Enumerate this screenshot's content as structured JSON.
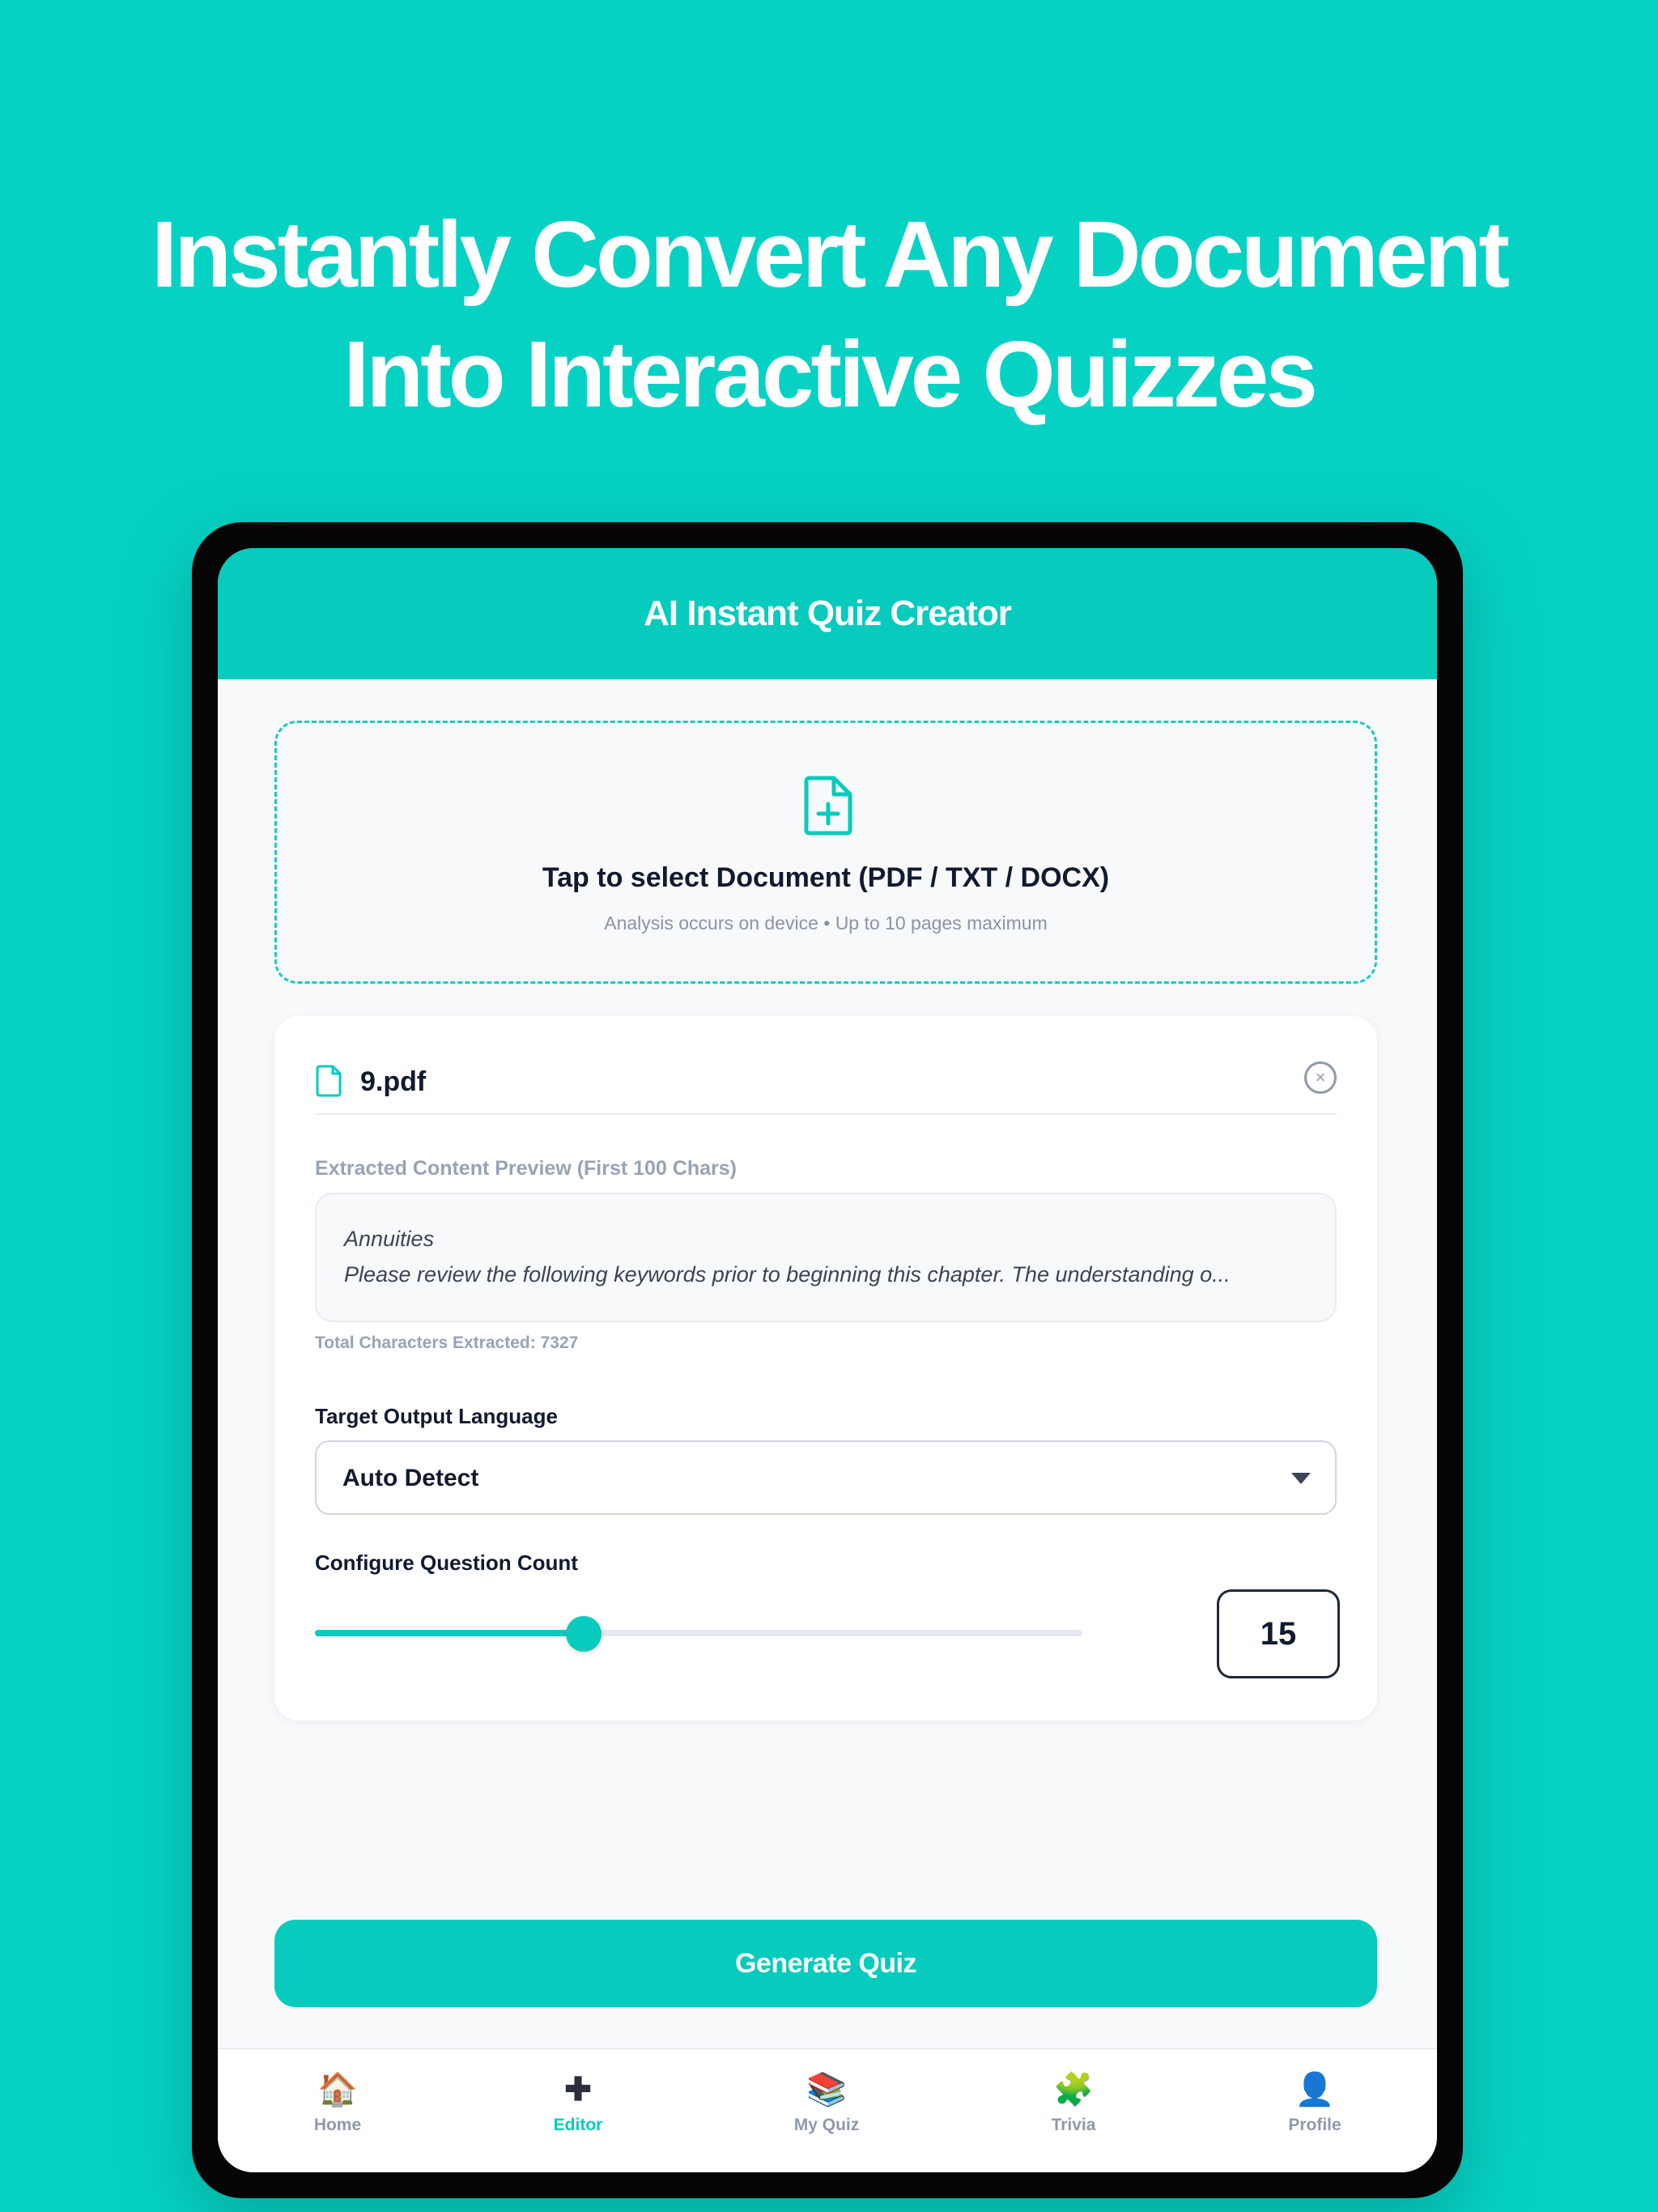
{
  "headline": {
    "line1": "Instantly Convert Any Document",
    "line2": "Into Interactive Quizzes"
  },
  "app": {
    "title": "AI Instant Quiz Creator"
  },
  "upload": {
    "icon": "file-plus-icon",
    "title": "Tap to select Document (PDF / TXT / DOCX)",
    "subtitle": "Analysis occurs on device • Up to 10 pages maximum"
  },
  "file": {
    "icon": "document-icon",
    "name": "9.pdf",
    "remove_icon": "close-circle-icon",
    "remove_symbol": "×"
  },
  "preview": {
    "label": "Extracted Content Preview (First 100 Chars)",
    "line1": "Annuities",
    "line2": "Please review the following keywords prior to beginning this chapter. The understanding o...",
    "char_count": "Total Characters Extracted: 7327"
  },
  "language": {
    "label": "Target Output Language",
    "value": "Auto Detect"
  },
  "question_count": {
    "label": "Configure Question Count",
    "value": "15",
    "slider_fraction": 0.35
  },
  "generate_button": "Generate Quiz",
  "tabs": [
    {
      "icon": "🏠",
      "icon_name": "home-icon",
      "label": "Home",
      "active": false
    },
    {
      "icon": "✚",
      "icon_name": "plus-icon",
      "label": "Editor",
      "active": true
    },
    {
      "icon": "📚",
      "icon_name": "books-icon",
      "label": "My Quiz",
      "active": false
    },
    {
      "icon": "🧩",
      "icon_name": "puzzle-icon",
      "label": "Trivia",
      "active": false
    },
    {
      "icon": "👤",
      "icon_name": "user-icon",
      "label": "Profile",
      "active": false
    }
  ],
  "colors": {
    "brand": "#06CBBD",
    "background": "#06D2C4",
    "text_dark": "#111a2e",
    "muted": "#98a3b4"
  }
}
